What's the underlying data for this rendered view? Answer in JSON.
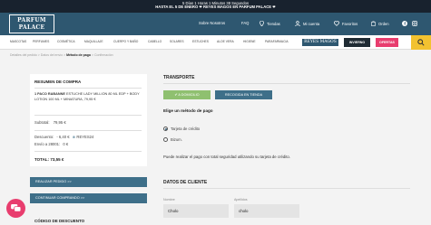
{
  "topbar": {
    "countdown": "5 Días 1 Horas 1 Minutos 38 Segundos",
    "promo": "HASTA EL 5 DE ENERO ❤ REYES MAGOS EN PARFUM PALACE ❤"
  },
  "header": {
    "logo_line1": "PARFUM",
    "logo_line2": "PALACE",
    "nosotros": "Sobre Nosotros",
    "faq": "FAQ",
    "tiendas": "Tiendas",
    "cuenta": "Mi cuenta",
    "favoritos": "Favoritos",
    "orden": "Orden"
  },
  "cats": [
    "MASCOTAS",
    "PERFUMES",
    "COSMÉTICA",
    "MAQUILLAJE",
    "CUERPO Y BAÑO",
    "CABELLO",
    "SOLARES",
    "ESTUCHES",
    "ALOE VERA",
    "HIGIENE",
    "PARAFARMACIA"
  ],
  "reyes_magos": "REYES MAGOS",
  "invierno": "INVIERNO",
  "ofertas": "OFERTAS",
  "breadcrumb": {
    "a": "Detalles del pedido",
    "b": "Datos del envío",
    "c": "Método de pago",
    "d": "Confirmación",
    "sep": ">"
  },
  "summary": {
    "title": "RESUMEN DE COMPRA",
    "product_bold": "1 PACO RABANNE",
    "product_rest": "ESTUCHE LADY MILLION 80 ML EDP + BODY LOTION 100 ML + MINIATURA",
    "product_price": "79,95 €",
    "subtotal_label": "Subtotal:",
    "subtotal": "79,95 €",
    "descuento_label": "Descuento:",
    "descuento": "- 6,40 €",
    "code": "REYES24",
    "envio_label": "Envío a 28001:",
    "envio": "0 €",
    "total": "TOTAL: 73,55 €"
  },
  "buttons": {
    "realizar": "REALIZAR PEDIDO >>",
    "continuar": "CONTINUAR COMPRANDO >>"
  },
  "codigo": "CÓDIGO DE DESCUENTO",
  "transport": {
    "title": "TRANSPORTE",
    "domicilio": "A DOMICILIO",
    "recogida": "RECOGIDA EN TIENDA"
  },
  "payment": {
    "title": "Elige un método de pago",
    "tarjeta": "Tarjeta de crédito",
    "bizum": "Bizum.",
    "info": "Puede realizar el pago con total seguridad utilizando su tarjeta de crédito."
  },
  "client": {
    "title": "DATOS DE CLIENTE",
    "nombre_label": "Nombre",
    "nombre": "Cholo",
    "apellidos_label": "Apellidos",
    "apellidos": "cholo"
  },
  "colors": {
    "header": "#2e5770",
    "accent_pink": "#e83d6e",
    "green": "#8fc070",
    "yellow": "#f2c230"
  }
}
